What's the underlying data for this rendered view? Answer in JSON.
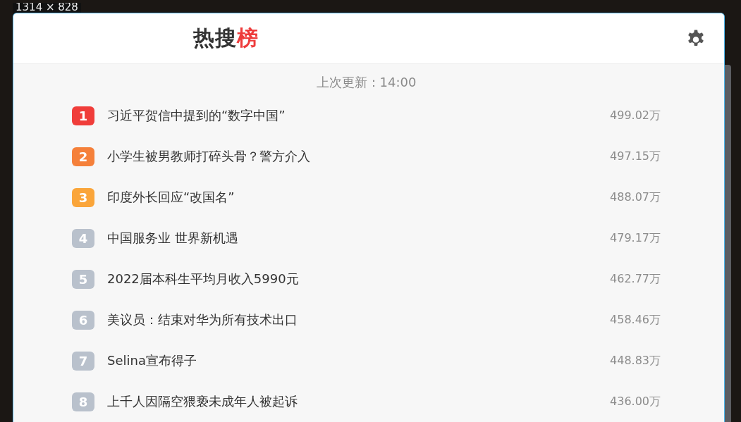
{
  "capture_size": "1314 × 828",
  "header": {
    "title": "热搜",
    "title_accent": "榜"
  },
  "last_update": "上次更新：14:00",
  "items": [
    {
      "rank": "1",
      "title": "习近平贺信中提到的“数字中国”",
      "heat": "499.02万",
      "color": "#f03d3a"
    },
    {
      "rank": "2",
      "title": "小学生被男教师打碎头骨？警方介入",
      "heat": "497.15万",
      "color": "#f5803a"
    },
    {
      "rank": "3",
      "title": "印度外长回应“改国名”",
      "heat": "488.07万",
      "color": "#faa53a"
    },
    {
      "rank": "4",
      "title": "中国服务业 世界新机遇",
      "heat": "479.17万",
      "color": "#b9c1cc"
    },
    {
      "rank": "5",
      "title": "2022届本科生平均月收入5990元",
      "heat": "462.77万",
      "color": "#b9c1cc"
    },
    {
      "rank": "6",
      "title": "美议员：结束对华为所有技术出口",
      "heat": "458.46万",
      "color": "#b9c1cc"
    },
    {
      "rank": "7",
      "title": "Selina宣布得子",
      "heat": "448.83万",
      "color": "#b9c1cc"
    },
    {
      "rank": "8",
      "title": "上千人因隔空猥亵未成年人被起诉",
      "heat": "436.00万",
      "color": "#b9c1cc"
    }
  ]
}
